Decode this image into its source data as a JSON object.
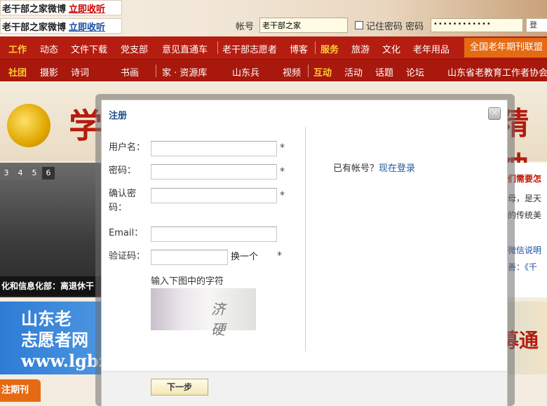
{
  "topbar": {
    "weibo1": {
      "name": "老干部之家微博",
      "link": "立即收听"
    },
    "weibo2": {
      "name": "老干部之家微博",
      "link": "立即收听"
    },
    "account_label": "帐号",
    "account_value": "老干部之家",
    "remember_label": "记住密码 密码",
    "password_mask": "••••••••••••",
    "login_button": "登"
  },
  "nav1": {
    "items": [
      "工作",
      "动态",
      "文件下载",
      "党支部",
      "意见直通车",
      "老干部志愿者",
      "博客",
      "服务",
      "旅游",
      "文化",
      "老年用品"
    ],
    "banner": "全国老年期刊联盟"
  },
  "nav2": {
    "items": [
      "社团",
      "摄影",
      "诗词",
      "书画",
      "家 · 资源库",
      "山东兵",
      "视频",
      "互动",
      "活动",
      "话题",
      "论坛"
    ],
    "banner": "山东省老教育工作者协会"
  },
  "hero": {
    "left_char": "学",
    "right_text": "精神"
  },
  "photo": {
    "pager": [
      "3",
      "4",
      "5",
      "6"
    ],
    "caption": "化和信息化部：离退休干"
  },
  "right_news": {
    "title": "们需要怎",
    "line1": "母，是天",
    "line2": "的传统美",
    "line3": "微信说明",
    "line4": "善：《千"
  },
  "volunteer_banner": {
    "left_text": "山东老\n志愿者网\nwww.lgbz",
    "right_text": "募通"
  },
  "journal_tab": "注期刊",
  "dialog": {
    "title": "注册",
    "close": "✕",
    "username_label": "用户名：",
    "password_label": "密码：",
    "confirm_label": "确认密码：",
    "email_label": "Email：",
    "captcha_label": "验证码：",
    "refresh_captcha": "换一个",
    "required_mark": "*",
    "captcha_hint": "输入下图中的字符",
    "captcha_chars": "济 硬",
    "have_account": "已有帐号？",
    "login_now": "现在登录",
    "next_button": "下一步"
  }
}
